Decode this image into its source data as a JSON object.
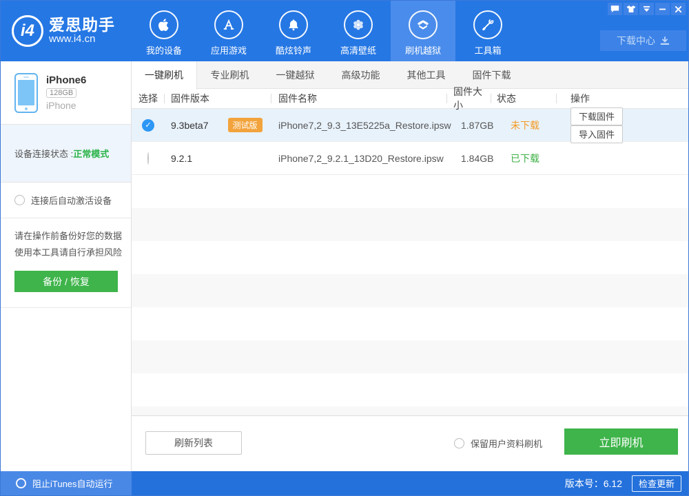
{
  "header": {
    "logo": {
      "badge": "i4",
      "title": "爱思助手",
      "subtitle": "www.i4.cn"
    },
    "nav": [
      {
        "label": "我的设备",
        "icon": "apple-icon",
        "active": false
      },
      {
        "label": "应用游戏",
        "icon": "appstore-icon",
        "active": false
      },
      {
        "label": "酷炫铃声",
        "icon": "bell-icon",
        "active": false
      },
      {
        "label": "高清壁纸",
        "icon": "wallpaper-icon",
        "active": false
      },
      {
        "label": "刷机越狱",
        "icon": "flash-box-icon",
        "active": true
      },
      {
        "label": "工具箱",
        "icon": "toolbox-icon",
        "active": false
      }
    ],
    "download_center_label": "下载中心"
  },
  "sidebar": {
    "device": {
      "name": "iPhone6",
      "capacity": "128GB",
      "type": "iPhone"
    },
    "connection": {
      "label": "设备连接状态 : ",
      "status": "正常模式"
    },
    "auto_activate_label": "连接后自动激活设备",
    "warning_line1": "请在操作前备份好您的数据",
    "warning_line2": "使用本工具请自行承担风险",
    "backup_button_label": "备份 / 恢复"
  },
  "tabs": [
    {
      "label": "一键刷机",
      "active": true
    },
    {
      "label": "专业刷机",
      "active": false
    },
    {
      "label": "一键越狱",
      "active": false
    },
    {
      "label": "高级功能",
      "active": false
    },
    {
      "label": "其他工具",
      "active": false
    },
    {
      "label": "固件下载",
      "active": false
    }
  ],
  "table": {
    "columns": {
      "select": "选择",
      "version": "固件版本",
      "name": "固件名称",
      "size": "固件大小",
      "status": "状态",
      "operation": "操作"
    },
    "rows": [
      {
        "selected": true,
        "version": "9.3beta7",
        "badge": "测试版",
        "name": "iPhone7,2_9.3_13E5225a_Restore.ipsw",
        "size": "1.87GB",
        "status": "未下载",
        "action_download": "下载固件",
        "action_import": "导入固件"
      },
      {
        "selected": false,
        "version": "9.2.1",
        "badge": "",
        "name": "iPhone7,2_9.2.1_13D20_Restore.ipsw",
        "size": "1.84GB",
        "status": "已下载"
      }
    ]
  },
  "actions": {
    "refresh_label": "刷新列表",
    "keep_user_data_label": "保留用户资料刷机",
    "flash_now_label": "立即刷机"
  },
  "footer": {
    "block_itunes_label": "阻止iTunes自动运行",
    "version_label": "版本号：6.12",
    "check_update_label": "检查更新"
  },
  "colors": {
    "header_blue": "#2577e4",
    "active_nav_blue": "#4a8ceb",
    "footer_blue": "#2471dc",
    "green": "#3eb44a",
    "orange_badge": "#f2a33c",
    "status_orange": "#f59a23",
    "status_green": "#3cb044",
    "selected_row_bg": "#e8f2fb",
    "radio_checked_blue": "#2d97f5"
  }
}
